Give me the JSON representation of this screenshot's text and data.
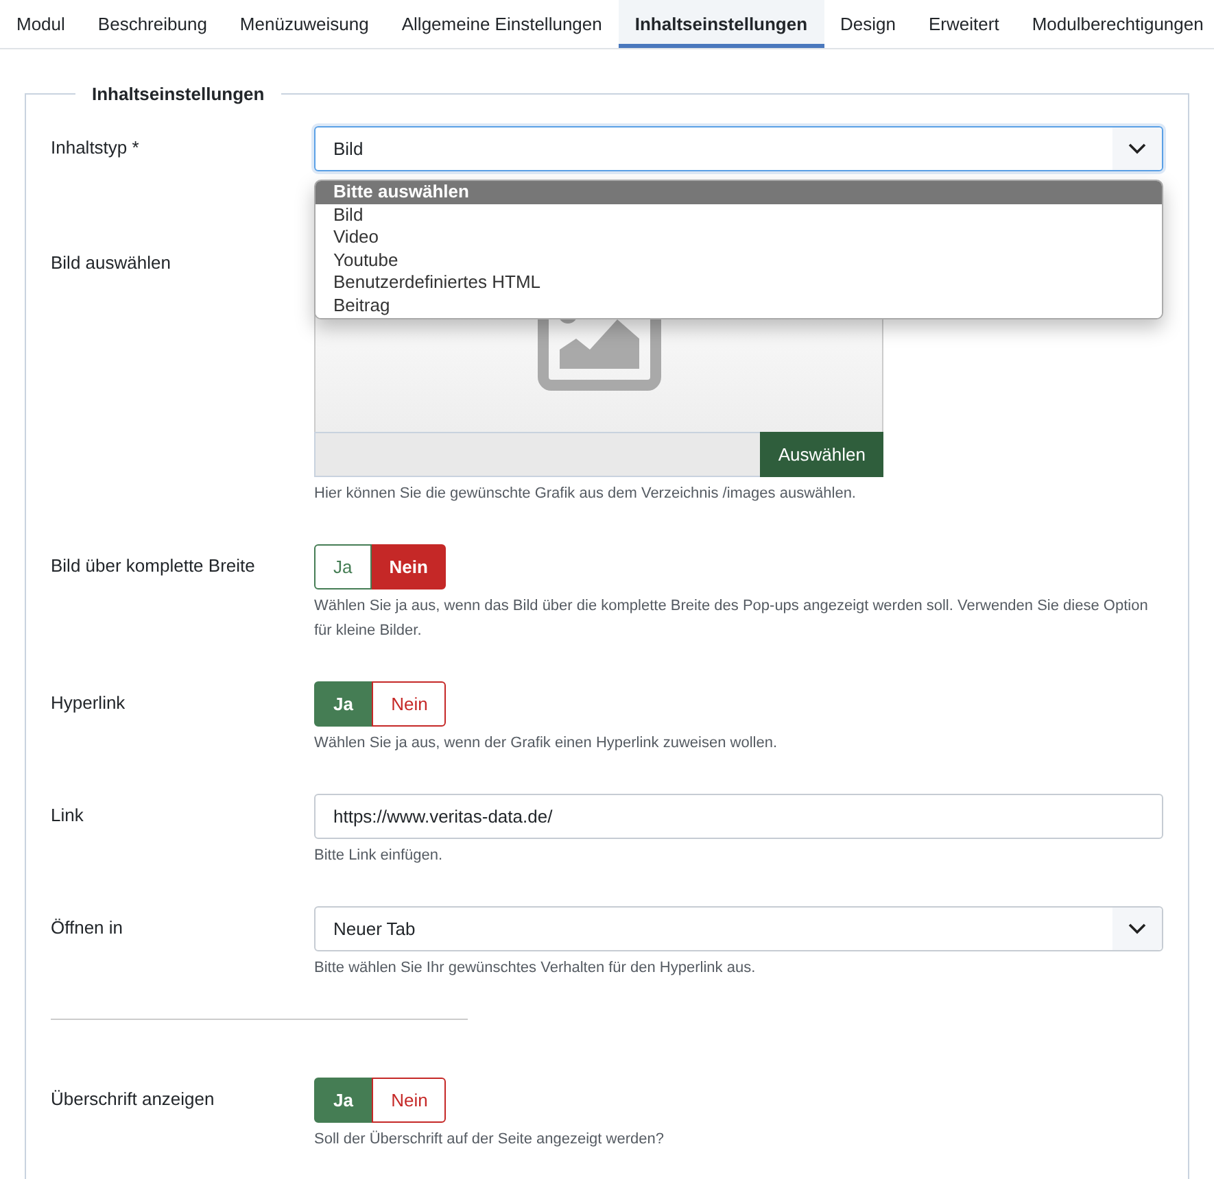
{
  "tabs": [
    {
      "label": "Modul",
      "selected": false
    },
    {
      "label": "Beschreibung",
      "selected": false
    },
    {
      "label": "Menüzuweisung",
      "selected": false
    },
    {
      "label": "Allgemeine Einstellungen",
      "selected": false
    },
    {
      "label": "Inhaltseinstellungen",
      "selected": true
    },
    {
      "label": "Design",
      "selected": false
    },
    {
      "label": "Erweitert",
      "selected": false
    },
    {
      "label": "Modulberechtigungen",
      "selected": false
    }
  ],
  "fieldset": {
    "legend": "Inhaltseinstellungen",
    "fields": [
      {
        "kind": "select",
        "label": "Inhaltstyp *",
        "value": "Bild",
        "focused": true,
        "dropdown": [
          {
            "label": "Bitte auswählen",
            "highlighted": true
          },
          {
            "label": "Bild",
            "highlighted": false
          },
          {
            "label": "Video",
            "highlighted": false
          },
          {
            "label": "Youtube",
            "highlighted": false
          },
          {
            "label": "Benutzerdefiniertes HTML",
            "highlighted": false
          },
          {
            "label": "Beitrag",
            "highlighted": false
          }
        ]
      },
      {
        "kind": "image",
        "label": "Bild auswählen",
        "button": "Auswählen",
        "help": "Hier können Sie die gewünschte Grafik aus dem Verzeichnis /images auswählen."
      },
      {
        "kind": "toggle",
        "label": "Bild über komplette Breite",
        "options": [
          {
            "label": "Ja",
            "selected": false
          },
          {
            "label": "Nein",
            "selected": true
          }
        ],
        "help": "Wählen Sie ja aus, wenn das Bild über die komplette Breite des Pop-ups angezeigt werden soll. Verwenden Sie diese Option für kleine Bilder."
      },
      {
        "kind": "toggle",
        "label": "Hyperlink",
        "options": [
          {
            "label": "Ja",
            "selected": true
          },
          {
            "label": "Nein",
            "selected": false
          }
        ],
        "help": "Wählen Sie ja aus, wenn der Grafik einen Hyperlink zuweisen wollen."
      },
      {
        "kind": "input",
        "label": "Link",
        "value": "https://www.veritas-data.de/",
        "help": "Bitte Link einfügen."
      },
      {
        "kind": "select",
        "label": "Öffnen in",
        "value": "Neuer Tab",
        "focused": false,
        "help": "Bitte wählen Sie Ihr gewünschtes Verhalten für den Hyperlink aus."
      },
      {
        "kind": "divider"
      },
      {
        "kind": "toggle",
        "label": "Überschrift anzeigen",
        "options": [
          {
            "label": "Ja",
            "selected": true
          },
          {
            "label": "Nein",
            "selected": false
          }
        ],
        "help": "Soll der Überschrift auf der Seite angezeigt werden?"
      }
    ]
  }
}
